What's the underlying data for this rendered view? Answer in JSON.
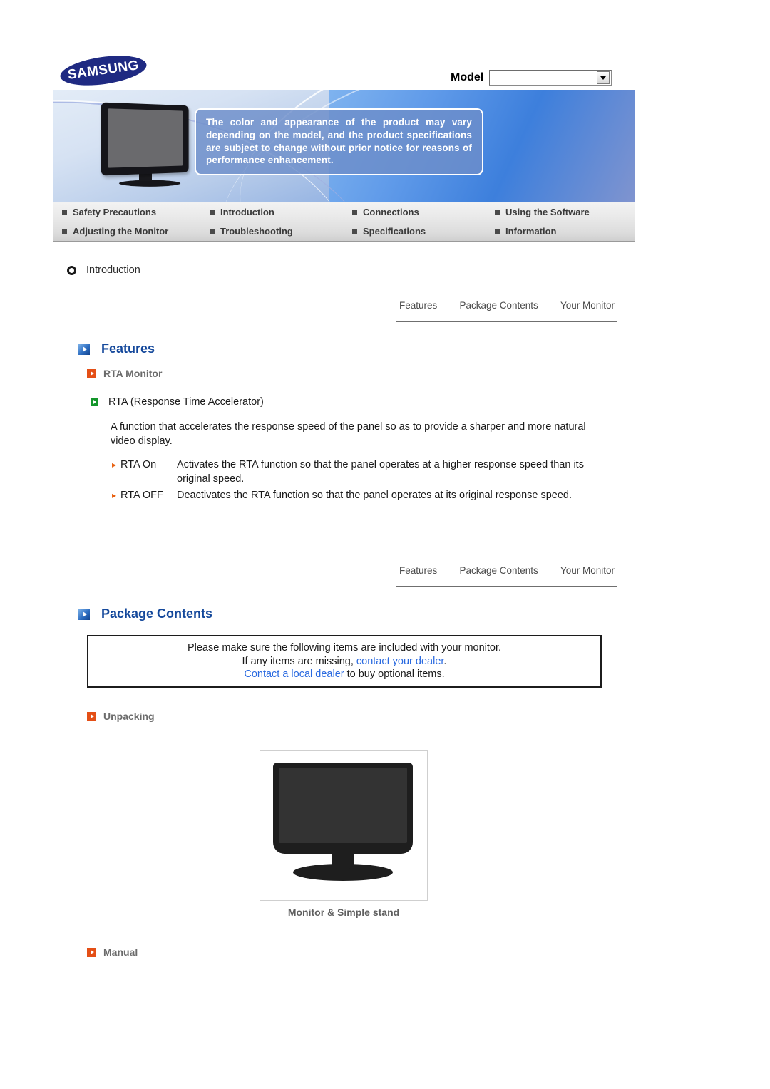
{
  "brand": {
    "logo_text": "SAMSUNG"
  },
  "header": {
    "model_label": "Model",
    "model_value": "",
    "model_placeholder": ""
  },
  "hero": {
    "notice": "The color and appearance of the product may vary depending on the model, and the product specifications are subject to change without prior notice for reasons of performance enhancement."
  },
  "nav": {
    "items": [
      "Safety Precautions",
      "Introduction",
      "Connections",
      "Using the Software",
      "Adjusting the Monitor",
      "Troubleshooting",
      "Specifications",
      "Information"
    ]
  },
  "breadcrumb": {
    "label": "Introduction"
  },
  "subtabs": {
    "items": [
      "Features",
      "Package Contents",
      "Your Monitor"
    ]
  },
  "features": {
    "heading": "Features",
    "subheading": "RTA Monitor",
    "item_title": "RTA (Response Time Accelerator)",
    "paragraph": "A function that accelerates the response speed of the panel so as to provide a sharper and more natural video display.",
    "definitions": [
      {
        "term": "RTA On",
        "desc": "Activates the RTA function so that the panel operates at a higher response speed than its original speed."
      },
      {
        "term": "RTA OFF",
        "desc": "Deactivates the RTA function so that the panel operates at its original response speed."
      }
    ]
  },
  "package": {
    "heading": "Package Contents",
    "notice": {
      "line1": "Please make sure the following items are included with your monitor.",
      "line2_pre": "If any items are missing, ",
      "line2_link": "contact your dealer",
      "line2_post": ".",
      "line3_link": "Contact a local dealer",
      "line3_post": " to buy optional items."
    },
    "unpacking_heading": "Unpacking",
    "product_caption": "Monitor & Simple stand",
    "manual_heading": "Manual"
  },
  "colors": {
    "brand_blue": "#1f2a82",
    "heading_blue": "#14489b",
    "link_blue": "#2a6ae0",
    "accent_orange": "#e44f16",
    "accent_green": "#14962b"
  },
  "icons": {
    "dropdown": "chevron-down-icon",
    "bullet": "square-bullet-icon",
    "circle": "circle-outline-icon",
    "arrow_blue": "blue-play-arrow-icon",
    "arrow_orange": "orange-play-arrow-icon",
    "arrow_green": "green-play-arrow-icon",
    "arrow_small": "small-right-arrow-icon"
  }
}
